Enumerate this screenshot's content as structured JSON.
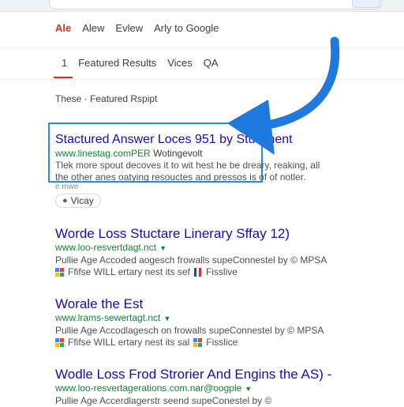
{
  "nav_primary": {
    "tabs": [
      {
        "label": "Ale",
        "active": true
      },
      {
        "label": "Alew",
        "active": false
      },
      {
        "label": "Evlew",
        "active": false
      },
      {
        "label": "Arly to Google",
        "active": false
      }
    ]
  },
  "nav_secondary": {
    "tabs": [
      {
        "label": "1",
        "active": true
      },
      {
        "label": "Featured Results",
        "active": false
      },
      {
        "label": "Vices",
        "active": false
      },
      {
        "label": "QA",
        "active": false
      }
    ]
  },
  "section_label": "These · Featured Rspipt",
  "featured": {
    "title": "Stactured Answer Loces 951 by Stuciment",
    "url": "www.linestag.comPER",
    "url_rest": "Wotingevolt",
    "snippet_1": "Tlek more spout decoves it to wit hest he be dreary, reaking, all",
    "snippet_2": "the other anes oatying resouctes and pressos is of of notler.",
    "snippet_3": "e mwe",
    "chip_label": "Vicay"
  },
  "results": [
    {
      "title": "Worde Loss Stuctare Linerary Sffay 12)",
      "url": "www.loo-resvertdagt.nct",
      "line1": "Pullie Age Accoded aogesch frowalls supeConnestel by © MPSA",
      "line2_a": "Ffifse WILL ertary nest its sef",
      "line2_b": "Fisslive"
    },
    {
      "title": "Worale the Est",
      "url": "www.lrams-sewertagt.nct",
      "line1": "Pullie Age Accodlagesch on frowalls supeConnestel by © MPSA",
      "line2_a": "Ffifse WILL ertary nest its sal",
      "line2_b": "Fisslice"
    },
    {
      "title": "Wodle Loss Frod Strorier And Engins the AS) -",
      "url": "www.loo-resvertagerations.com.nar@oogple",
      "line1": "Pullie Age Accerdlagerstr seend supeConestel by ©"
    }
  ]
}
